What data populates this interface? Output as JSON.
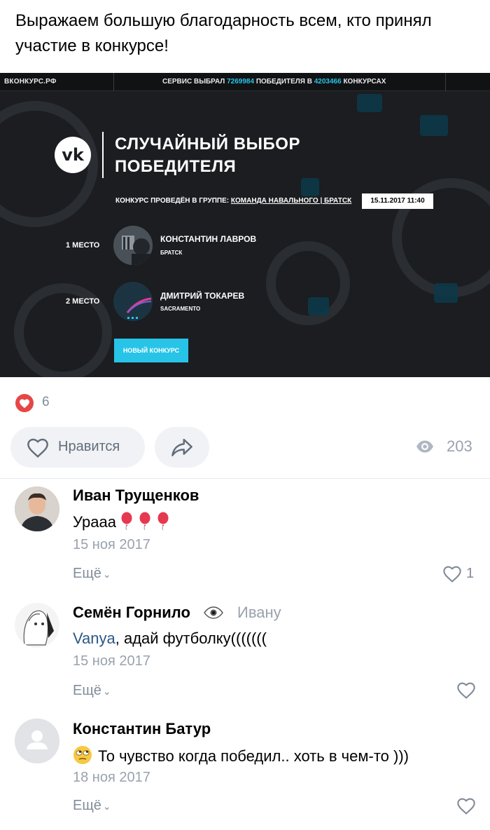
{
  "post": {
    "text": "Выражаем большую благодарность всем, кто принял участие в конкурсе!"
  },
  "contest_image": {
    "site_name": "ВКОНКУРС.РФ",
    "stats_prefix": "СЕРВИС ВЫБРАЛ ",
    "winners_total": "7269984",
    "stats_middle": " ПОБЕДИТЕЛЯ В ",
    "contests_total": "4203466",
    "stats_suffix": " КОНКУРСАХ",
    "logo_text": "vk",
    "heading": "СЛУЧАЙНЫЙ ВЫБОР ПОБЕДИТЕЛЯ",
    "info_prefix": "КОНКУРС ПРОВЕДЁН В ГРУППЕ: ",
    "group_name": "КОМАНДА НАВАЛЬНОГО | БРАТСК",
    "date": "15.11.2017 11:40",
    "winners": [
      {
        "place": "1 МЕСТО",
        "name": "КОНСТАНТИН ЛАВРОВ",
        "city": "БРАТСК"
      },
      {
        "place": "2 МЕСТО",
        "name": "ДМИТРИЙ ТОКАРЕВ",
        "city": "SACRAMENTO"
      }
    ],
    "new_contest_button": "НОВЫЙ КОНКУРС",
    "colors": {
      "accent": "#27c4e8",
      "background": "#1b1d20"
    }
  },
  "reactions": {
    "likes": "6",
    "like_label": "Нравится",
    "views": "203",
    "colors": {
      "like": "#e64646"
    }
  },
  "comments": [
    {
      "author": "Иван Трущенков",
      "text": "Урааа",
      "emoji": "balloon",
      "date": "15 ноя 2017",
      "more_label": "Ещё",
      "likes": "1"
    },
    {
      "author": "Семён Горнило",
      "reply_to": "Ивану",
      "mention": "Vanya",
      "text": ", адай футболку(((((((",
      "date": "15 ноя 2017",
      "more_label": "Ещё"
    },
    {
      "author": "Константин Батур",
      "emoji": "rolling-eyes-face",
      "text": "То чувство когда победил.. хоть в чем-то )))",
      "date": "18 ноя 2017",
      "more_label": "Ещё"
    }
  ]
}
